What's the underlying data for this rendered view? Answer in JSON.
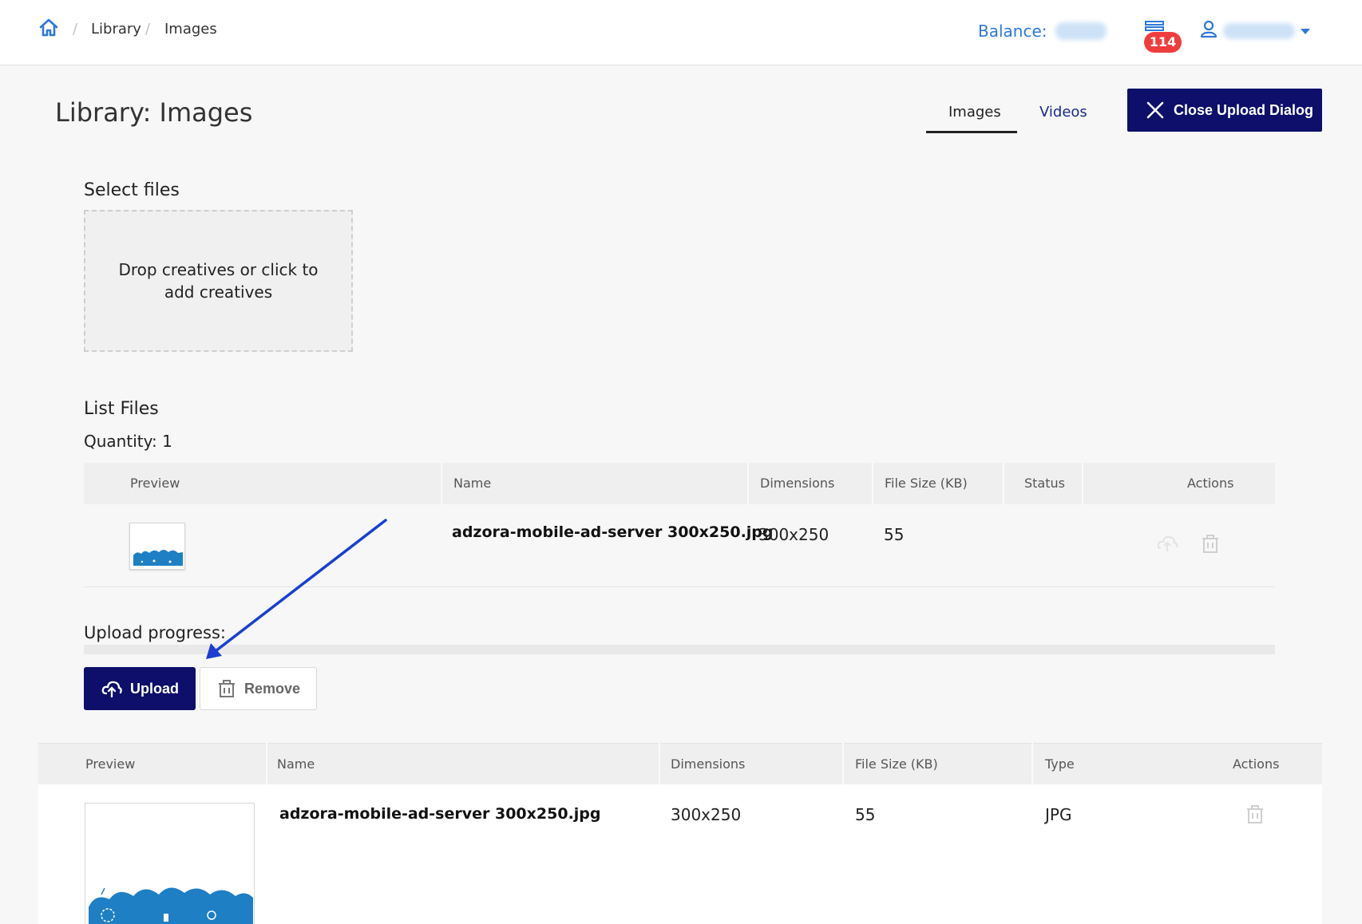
{
  "breadcrumb": {
    "library": "Library",
    "images": "Images"
  },
  "header": {
    "balance_label": "Balance:",
    "notifications_count": "114"
  },
  "page": {
    "title": "Library: Images"
  },
  "tabs": [
    {
      "label": "Images",
      "active": true
    },
    {
      "label": "Videos",
      "active": false
    }
  ],
  "close_dialog": {
    "label": "Close Upload Dialog"
  },
  "select_files": {
    "heading": "Select files",
    "dropzone_text": "Drop creatives or click to add creatives"
  },
  "list_files": {
    "heading": "List Files",
    "quantity": "Quantity: 1",
    "columns": [
      "Preview",
      "Name",
      "Dimensions",
      "File Size (KB)",
      "Status",
      "Actions"
    ],
    "rows": [
      {
        "name": "adzora-mobile-ad-server 300x250.jpg",
        "dimensions": "300x250",
        "size": "55",
        "status": ""
      }
    ]
  },
  "upload": {
    "progress_label": "Upload progress:",
    "progress": 0,
    "upload_label": "Upload",
    "remove_label": "Remove"
  },
  "library_table": {
    "columns": [
      "Preview",
      "Name",
      "Dimensions",
      "File Size (KB)",
      "Type",
      "Actions"
    ],
    "rows": [
      {
        "name": "adzora-mobile-ad-server 300x250.jpg",
        "dimensions": "300x250",
        "size": "55",
        "type": "JPG"
      }
    ]
  },
  "colors": {
    "primary": "#0d0f6b",
    "link": "#2f78d8",
    "badge": "#ef3d3d",
    "annotation": "#1a3fd1"
  }
}
